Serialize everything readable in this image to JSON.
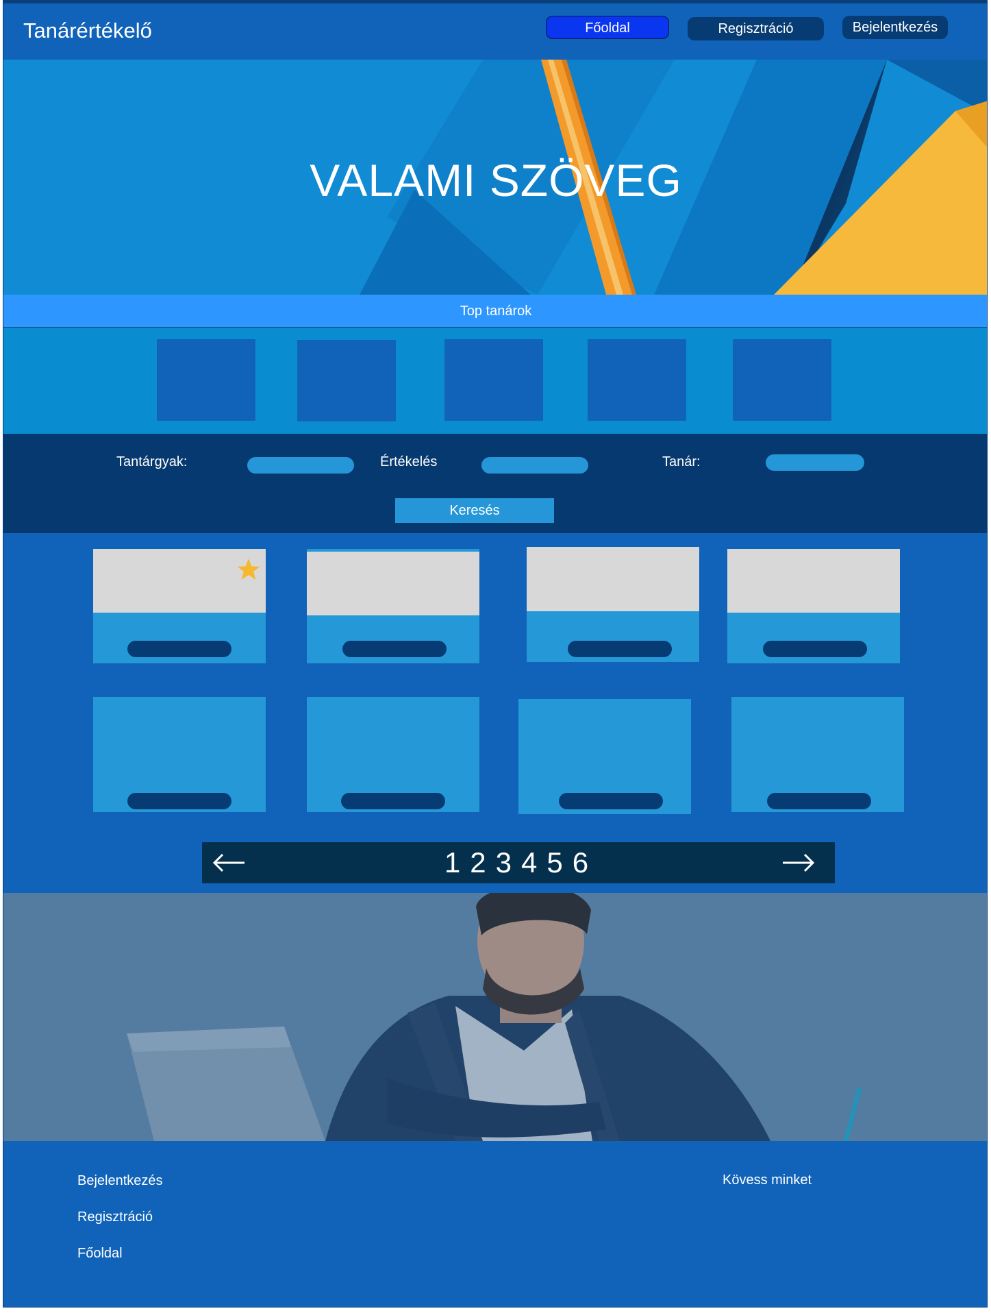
{
  "header": {
    "brand": "Tanárértékelő",
    "nav": {
      "home": "Főoldal",
      "register": "Regisztráció",
      "login": "Bejelentkezés"
    }
  },
  "hero": {
    "title": "VALAMI SZÖVEG"
  },
  "top_teachers": {
    "title": "Top tanárok",
    "count": 5
  },
  "filter": {
    "subjects_label": "Tantárgyak:",
    "rating_label": "Értékelés",
    "teacher_label": "Tanár:",
    "search_button": "Keresés"
  },
  "cards": {
    "count": 8,
    "favorite_icon": "star-icon",
    "star_color": "#f5b82e"
  },
  "pagination": {
    "prev_icon": "arrow-left-icon",
    "next_icon": "arrow-right-icon",
    "pages": [
      "1",
      "2",
      "3",
      "4",
      "5",
      "6"
    ]
  },
  "footer": {
    "links": [
      "Bejelentkezés",
      "Regisztráció",
      "Főoldal"
    ],
    "follow": "Kövess minket"
  },
  "colors": {
    "primary": "#1063b8",
    "dark": "#05396f",
    "accent": "#2596d8",
    "highlight": "#0a36f0"
  }
}
